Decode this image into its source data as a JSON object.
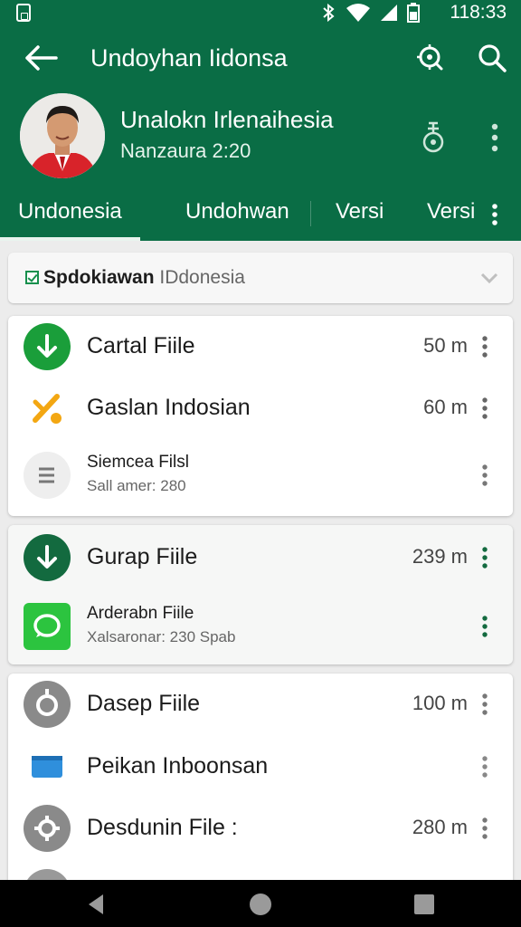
{
  "status_bar": {
    "time": "118:33"
  },
  "header": {
    "title": "Undoyhan Iidonsa",
    "profile_name": "Unalokn Irlenaihesia",
    "profile_subtitle": "Nanzaura 2:20"
  },
  "tabs": [
    "Undonesia",
    "Undohwan",
    "Versi",
    "Versi"
  ],
  "filter": {
    "bold": "Spdokiawan",
    "rest": " IDdonesia"
  },
  "cards": [
    {
      "rows": [
        {
          "icon": "download-icon",
          "title": "Cartal Fiile",
          "meta": "50 m"
        },
        {
          "icon": "tools-icon",
          "title": "Gaslan Indosian",
          "meta": "60 m"
        },
        {
          "icon": "document-icon",
          "title": "Siemcea Filsl",
          "subtitle": "Sall amer: 280",
          "meta": ""
        }
      ]
    },
    {
      "rows": [
        {
          "icon": "download-icon",
          "title": "Gurap Fiile",
          "meta": "239 m"
        },
        {
          "icon": "chat-icon",
          "title": "Arderabn Fiile",
          "subtitle": "Xalsaronar: 230 Spab",
          "meta": ""
        }
      ]
    },
    {
      "rows": [
        {
          "icon": "disc-icon",
          "title": "Dasep Fiile",
          "meta": "100 m"
        },
        {
          "icon": "card-icon",
          "title": "Peikan Inboonsan",
          "meta": ""
        },
        {
          "icon": "gear-icon",
          "title": "Desdunin File :",
          "meta": "280 m"
        }
      ]
    }
  ],
  "colors": {
    "primary": "#0a6d45",
    "accent_green": "#1a9e3a",
    "dark_green": "#136a3f"
  }
}
